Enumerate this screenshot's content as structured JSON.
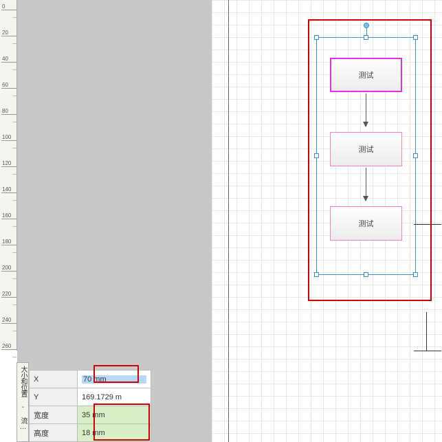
{
  "ruler": {
    "start": 0,
    "end": 260,
    "step": 20
  },
  "properties": {
    "panel_title": "大小和位置 - 流…",
    "rows": [
      {
        "label": "X",
        "value": "70 mm",
        "editing": true,
        "highlight": "red"
      },
      {
        "label": "Y",
        "value": "169.1729 m",
        "editing": false,
        "highlight": "none"
      },
      {
        "label": "宽度",
        "value": "35 mm",
        "editing": false,
        "highlight": "green"
      },
      {
        "label": "高度",
        "value": "18 mm",
        "editing": false,
        "highlight": "green"
      }
    ]
  },
  "canvas": {
    "nodes": [
      {
        "id": "node1",
        "text": "测试",
        "selected": true
      },
      {
        "id": "node2",
        "text": "测试",
        "selected": false
      },
      {
        "id": "node3",
        "text": "测试",
        "selected": false
      }
    ]
  }
}
